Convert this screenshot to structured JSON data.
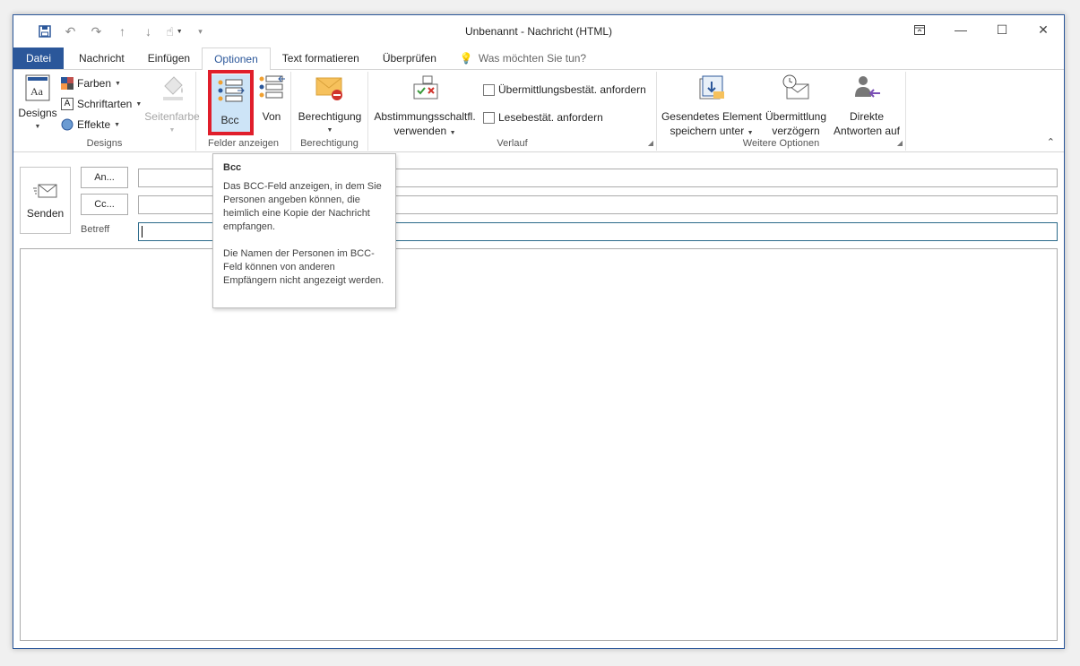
{
  "window": {
    "title": "Unbenannt - Nachricht (HTML)"
  },
  "tabs": [
    "Datei",
    "Nachricht",
    "Einfügen",
    "Optionen",
    "Text formatieren",
    "Überprüfen"
  ],
  "tell_me": "Was möchten Sie tun?",
  "ribbon": {
    "designs": {
      "label": "Designs",
      "button": "Designs",
      "farben": "Farben",
      "schriftarten": "Schriftarten",
      "effekte": "Effekte",
      "seitenfarbe": "Seitenfarbe"
    },
    "felder": {
      "label": "Felder anzeigen",
      "bcc": "Bcc",
      "von": "Von"
    },
    "berechtigung": {
      "label": "Berechtigung",
      "button": "Berechtigung"
    },
    "verlauf": {
      "label": "Verlauf",
      "abstimmung_l1": "Abstimmungsschaltfl.",
      "abstimmung_l2": "verwenden",
      "uebermittlung": "Übermittlungsbestät. anfordern",
      "lese": "Lesebestät. anfordern"
    },
    "weitere": {
      "label": "Weitere Optionen",
      "gesendet_l1": "Gesendetes Element",
      "gesendet_l2": "speichern unter",
      "verz_l1": "Übermittlung",
      "verz_l2": "verzögern",
      "direkt_l1": "Direkte",
      "direkt_l2": "Antworten auf"
    }
  },
  "compose": {
    "send": "Senden",
    "to": "An...",
    "cc": "Cc...",
    "subject": "Betreff"
  },
  "tooltip": {
    "title": "Bcc",
    "p1": "Das BCC-Feld anzeigen, in dem Sie Personen angeben können, die heimlich eine Kopie der Nachricht empfangen.",
    "p2": "Die Namen der Personen im BCC-Feld können von anderen Empfängern nicht angezeigt werden."
  }
}
